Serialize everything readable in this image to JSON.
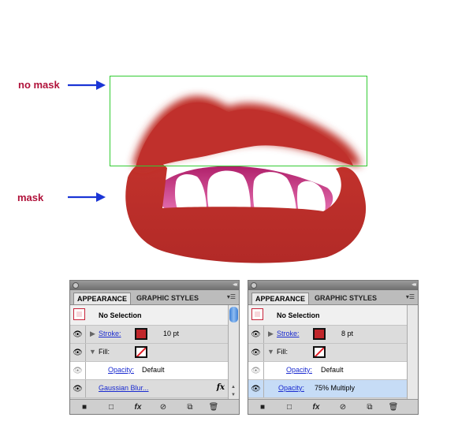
{
  "annotations": {
    "no_mask": "no mask",
    "mask": "mask"
  },
  "colors": {
    "lip": "#c0302c",
    "guide": "#33cc33",
    "arrow": "#1a35d6",
    "annot": "#b0123a"
  },
  "panels": [
    {
      "tabs": [
        "APPEARANCE",
        "GRAPHIC STYLES"
      ],
      "selection": "No Selection",
      "stroke_label": "Stroke:",
      "stroke_value": "10 pt",
      "fill_label": "Fill:",
      "opacity_label": "Opacity:",
      "opacity_value": "Default",
      "effect_label": "Gaussian Blur...",
      "effect_icon": "fx-icon"
    },
    {
      "tabs": [
        "APPEARANCE",
        "GRAPHIC STYLES"
      ],
      "selection": "No Selection",
      "stroke_label": "Stroke:",
      "stroke_value": "8 pt",
      "fill_label": "Fill:",
      "opacity_label": "Opacity:",
      "opacity_value": "Default",
      "opacity2_label": "Opacity:",
      "opacity2_value": "75% Multiply"
    }
  ]
}
